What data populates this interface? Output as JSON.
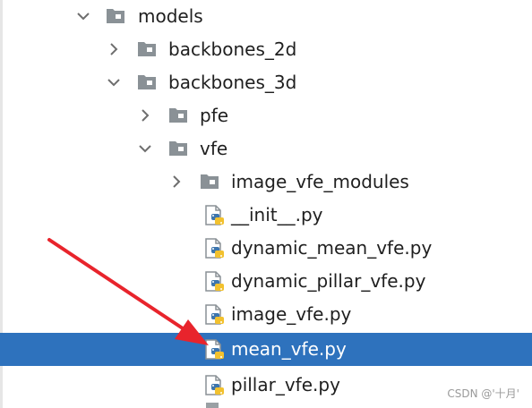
{
  "tree": {
    "rows": [
      {
        "label": "models",
        "type": "folder",
        "chevron": "down"
      },
      {
        "label": "backbones_2d",
        "type": "folder",
        "chevron": "right"
      },
      {
        "label": "backbones_3d",
        "type": "folder",
        "chevron": "down"
      },
      {
        "label": "pfe",
        "type": "folder",
        "chevron": "right"
      },
      {
        "label": "vfe",
        "type": "folder",
        "chevron": "down"
      },
      {
        "label": "image_vfe_modules",
        "type": "folder",
        "chevron": "right"
      },
      {
        "label": "__init__.py",
        "type": "python-file"
      },
      {
        "label": "dynamic_mean_vfe.py",
        "type": "python-file"
      },
      {
        "label": "dynamic_pillar_vfe.py",
        "type": "python-file"
      },
      {
        "label": "image_vfe.py",
        "type": "python-file"
      },
      {
        "label": "mean_vfe.py",
        "type": "python-file",
        "selected": true
      },
      {
        "label": "pillar_vfe.py",
        "type": "python-file"
      }
    ]
  },
  "annotation": {
    "arrow_color": "#e8242c",
    "points_to": "mean_vfe.py"
  },
  "watermark": {
    "text": "CSDN @'十月'"
  },
  "colors": {
    "selection": "#2e72bd",
    "folder": "#8a9196",
    "python_blue": "#3d75ad",
    "python_yellow": "#f2c12e"
  }
}
